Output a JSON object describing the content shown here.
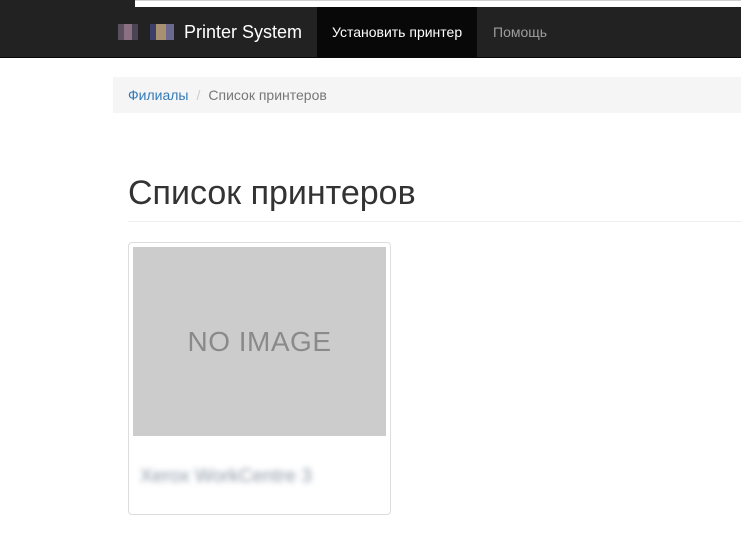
{
  "navbar": {
    "brand_title": "Printer System",
    "items": [
      {
        "label": "Установить принтер",
        "active": true
      },
      {
        "label": "Помощь",
        "active": false
      }
    ]
  },
  "breadcrumb": {
    "link_label": "Филиалы",
    "separator": "/",
    "current_label": "Список принтеров"
  },
  "page": {
    "title": "Список принтеров"
  },
  "printers": [
    {
      "image_placeholder": "NO IMAGE",
      "name": "Xerox WorkCentre 3"
    }
  ],
  "colors": {
    "navbar_bg": "#222222",
    "navbar_active_bg": "#080808",
    "link": "#337ab7",
    "placeholder_bg": "#cccccc"
  }
}
